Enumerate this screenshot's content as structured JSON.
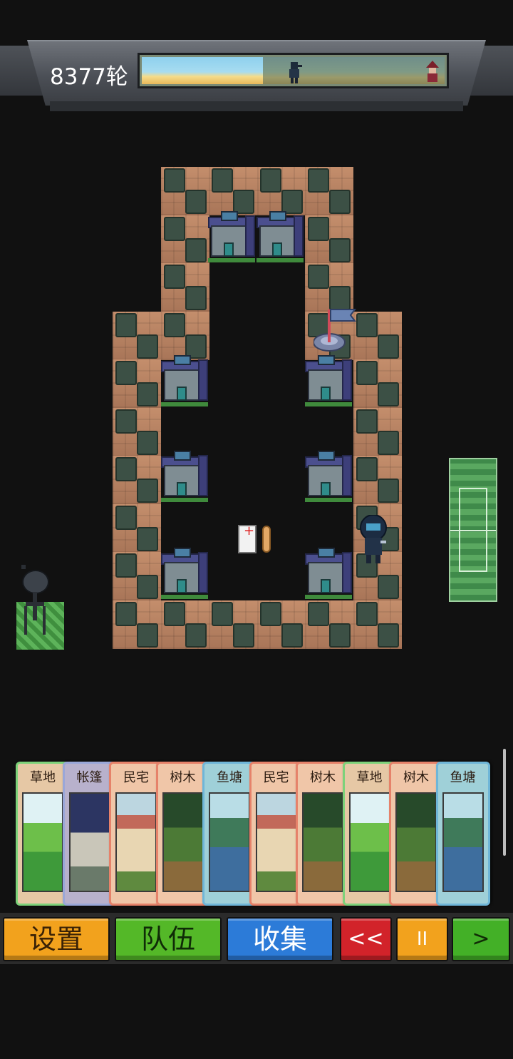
{
  "hud": {
    "round_label": "8377轮",
    "progress_fraction": 0.4
  },
  "hand": {
    "cards": [
      {
        "label": "草地",
        "kind": "grass"
      },
      {
        "label": "帐篷",
        "kind": "tent"
      },
      {
        "label": "民宅",
        "kind": "house"
      },
      {
        "label": "树木",
        "kind": "tree"
      },
      {
        "label": "鱼塘",
        "kind": "pond"
      },
      {
        "label": "民宅",
        "kind": "house"
      },
      {
        "label": "树木",
        "kind": "tree"
      },
      {
        "label": "草地",
        "kind": "grass"
      },
      {
        "label": "树木",
        "kind": "tree"
      },
      {
        "label": "鱼塘",
        "kind": "pond"
      }
    ]
  },
  "toolbar": {
    "settings_label": "设置",
    "team_label": "队伍",
    "collect_label": "收集",
    "rewind_label": "<<",
    "pause_label": "II",
    "next_label": ">"
  },
  "colors": {
    "background": "#111111",
    "settings_button": "#f2a21d",
    "team_button": "#54b828",
    "collect_button": "#2c7bd8",
    "rewind_button": "#d2232a",
    "next_button": "#43b027"
  }
}
